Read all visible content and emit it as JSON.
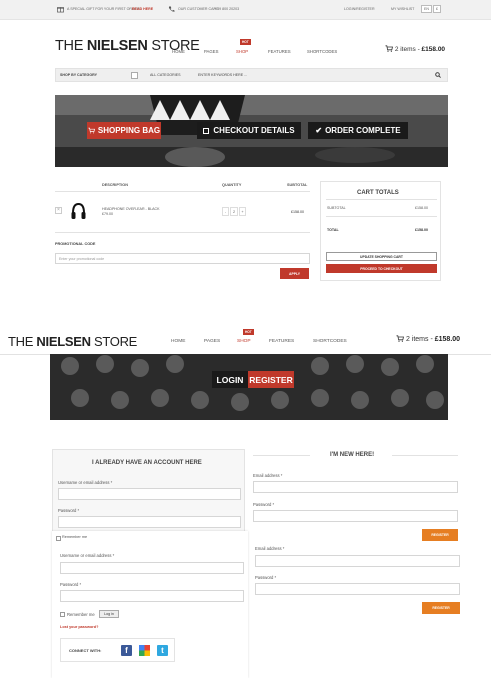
{
  "topbar": {
    "gift_text": "A SPECIAL GIFT FOR YOUR FIRST ORDER!",
    "gift_link": "READ HERE",
    "care_text": "OUR CUSTOMER CARE",
    "care_phone": "+ 39 800 20203",
    "login_register": "LOGIN/REGISTER",
    "wishlist": "MY WISHLIST",
    "lang_label": "EN",
    "currency_label": "£"
  },
  "header": {
    "logo_thin": "THE",
    "logo_bold": "NIELSEN",
    "logo_thin2": "STORE",
    "nav": [
      "HOME",
      "PAGES",
      "SHOP",
      "FEATURES",
      "SHORTCODES"
    ],
    "hot_badge": "HOT",
    "cart_items": "2 items -",
    "cart_total": "£158.00"
  },
  "search": {
    "category": "SHOP BY CATEGORY",
    "all_categories": "ALL CATEGORIES",
    "placeholder": "ENTER KEYWORDS HERE ..."
  },
  "steps": {
    "shopping_bag": "SHOPPING BAG",
    "checkout_details": "CHECKOUT DETAILS",
    "order_complete": "ORDER COMPLETE"
  },
  "cart_table": {
    "headers": [
      "DESCRIPTION",
      "QUANTITY",
      "SUBTOTAL"
    ],
    "item_name": "HEADPHONE OVER-EAR - BLACK",
    "item_price": "£79.00",
    "item_qty": "2",
    "item_subtotal": "£158.00"
  },
  "promo": {
    "title": "PROMOTIONAL CODE",
    "placeholder": "Enter your promotional code",
    "apply": "APPLY"
  },
  "totals": {
    "title": "CART TOTALS",
    "subtotal_label": "SUBTOTAL",
    "subtotal_value": "£158.00",
    "total_label": "TOTAL",
    "total_value": "£158.00",
    "update_button": "UPDATE SHOPPING CART",
    "checkout_button": "PROCEED TO CHECKOUT"
  },
  "login_page": {
    "banner_login": "LOGIN",
    "banner_register": "REGISTER",
    "account_heading": "I ALREADY HAVE AN ACCOUNT HERE",
    "new_heading": "I'M NEW HERE!",
    "username_label": "Username or email address *",
    "password_label": "Password *",
    "email_label": "Email address *",
    "remember": "Remember me",
    "login_button": "Log in",
    "lost_password": "Lost your password?",
    "register_button": "REGISTER",
    "connect_with": "CONNECT WITH:",
    "social": [
      "f",
      "g+",
      "t"
    ]
  },
  "colors": {
    "accent": "#c0392b",
    "orange": "#e67e22",
    "facebook": "#3b5998",
    "twitter": "#2fa8e0"
  }
}
